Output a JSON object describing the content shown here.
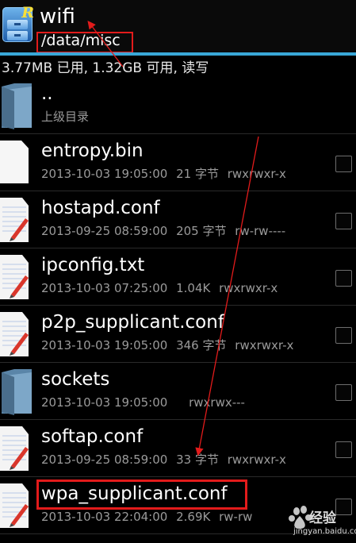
{
  "header": {
    "title": "wifi",
    "path": "/data/misc"
  },
  "storage": {
    "status": "3.77MB 已用, 1.32GB 可用, 读写"
  },
  "files": [
    {
      "name": "..",
      "date": "",
      "size": "",
      "perms": "",
      "subtitle": "上级目录",
      "type": "folder"
    },
    {
      "name": "entropy.bin",
      "date": "2013-10-03 19:05:00",
      "size": "21 字节",
      "perms": "rwxrwxr-x",
      "type": "file"
    },
    {
      "name": "hostapd.conf",
      "date": "2013-09-25 08:59:00",
      "size": "205 字节",
      "perms": "rw-rw----",
      "type": "doc"
    },
    {
      "name": "ipconfig.txt",
      "date": "2013-10-03 07:25:00",
      "size": "1.04K",
      "perms": "rwxrwxr-x",
      "type": "doc"
    },
    {
      "name": "p2p_supplicant.conf",
      "date": "2013-10-03 19:05:00",
      "size": "346 字节",
      "perms": "rwxrwxr-x",
      "type": "doc"
    },
    {
      "name": "sockets",
      "date": "2013-10-03 19:05:00",
      "size": "",
      "perms": "rwxrwx---",
      "type": "folder"
    },
    {
      "name": "softap.conf",
      "date": "2013-09-25 08:59:00",
      "size": "33 字节",
      "perms": "rwxrwxr-x",
      "type": "doc"
    },
    {
      "name": "wpa_supplicant.conf",
      "date": "2013-10-03 22:04:00",
      "size": "2.69K",
      "perms": "rw-rw",
      "type": "doc"
    }
  ],
  "watermark": {
    "text": "经验",
    "url": "jingyan.baidu.com"
  },
  "colors": {
    "accent": "#39a7d8",
    "highlight": "#e21b1b",
    "background": "#000000"
  }
}
